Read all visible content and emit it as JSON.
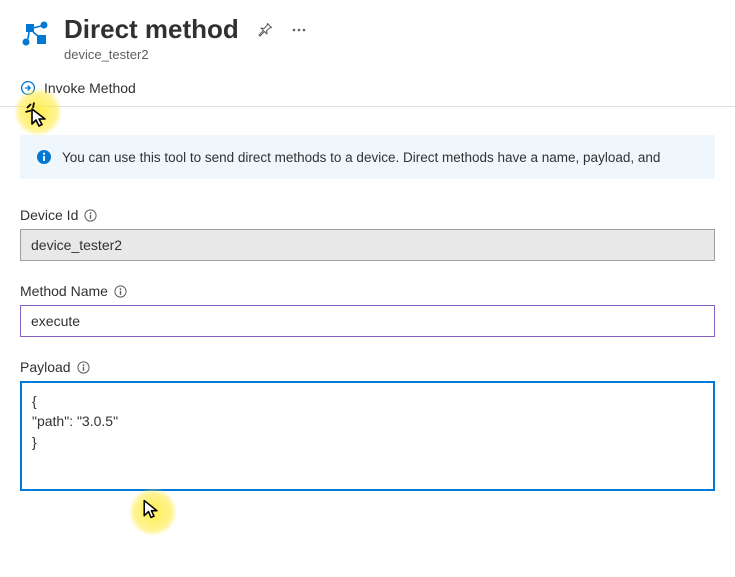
{
  "header": {
    "title": "Direct method",
    "subtitle": "device_tester2"
  },
  "commandBar": {
    "invoke_label": "Invoke Method"
  },
  "info": {
    "text": "You can use this tool to send direct methods to a device. Direct methods have a name, payload, and"
  },
  "fields": {
    "deviceId": {
      "label": "Device Id",
      "value": "device_tester2"
    },
    "methodName": {
      "label": "Method Name",
      "value": "execute"
    },
    "payload": {
      "label": "Payload",
      "value": "{\n\"path\": \"3.0.5\"\n}"
    }
  }
}
